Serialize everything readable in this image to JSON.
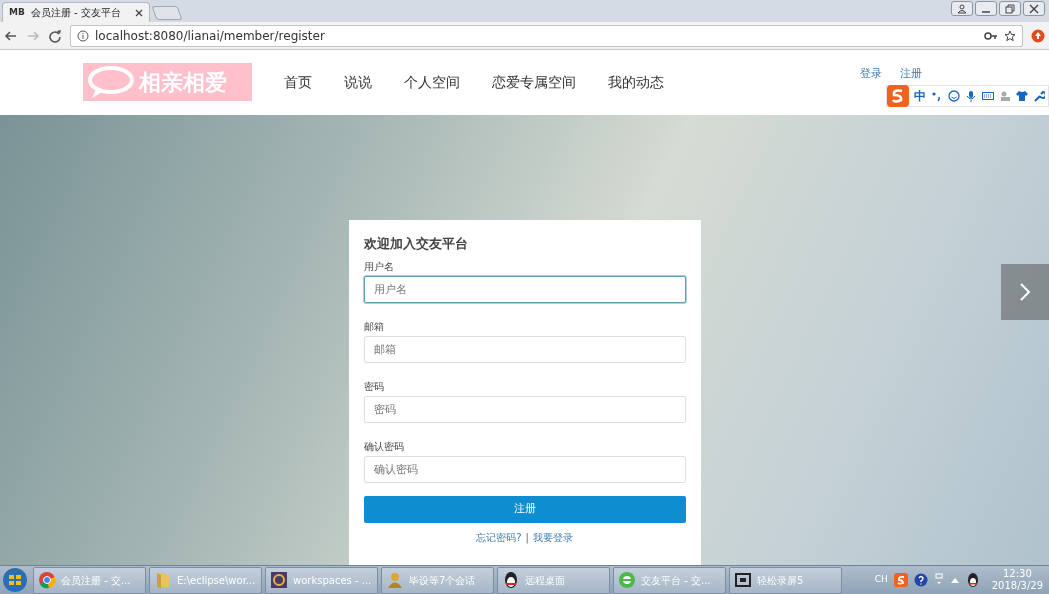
{
  "browser": {
    "tab": {
      "favicon": "MB",
      "title": "会员注册 - 交友平台"
    },
    "address": "localhost:8080/lianai/member/register"
  },
  "nav": {
    "logo": "相亲相爱",
    "items": [
      {
        "label": "首页"
      },
      {
        "label": "说说"
      },
      {
        "label": "个人空间"
      },
      {
        "label": "恋爱专属空间"
      },
      {
        "label": "我的动态"
      }
    ],
    "links": [
      "登录",
      "注册"
    ]
  },
  "ime_bar": {
    "mode": "中"
  },
  "form": {
    "title": "欢迎加入交友平台",
    "fields": [
      {
        "label": "用户名",
        "placeholder": "用户名",
        "focused": true
      },
      {
        "label": "邮箱",
        "placeholder": "邮箱",
        "focused": false
      },
      {
        "label": "密码",
        "placeholder": "密码",
        "focused": false
      },
      {
        "label": "确认密码",
        "placeholder": "确认密码",
        "focused": false
      }
    ],
    "submit": "注册",
    "links": [
      {
        "kind": "link",
        "text": "忘记密码?"
      },
      {
        "kind": "separator",
        "text": "|"
      },
      {
        "kind": "link",
        "text": "我要登录"
      }
    ]
  },
  "taskbar": {
    "items": [
      {
        "label": "会员注册 - 交..."
      },
      {
        "label": "E:\\eclipse\\wor..."
      },
      {
        "label": "workspaces - ..."
      },
      {
        "label": "毕设等7个会话"
      },
      {
        "label": "远程桌面"
      },
      {
        "label": "交友平台 - 交..."
      },
      {
        "label": "轻松录屏5"
      }
    ],
    "tray": {
      "lang": "CH",
      "time": "12:30",
      "date": "2018/3/29"
    }
  }
}
